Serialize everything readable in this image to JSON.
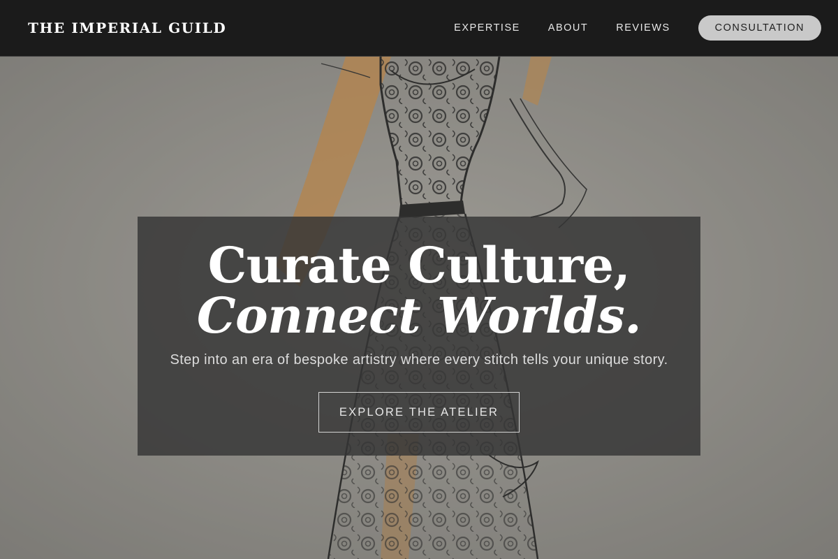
{
  "nav": {
    "brand": "THE IMPERIAL GUILD",
    "links": [
      "EXPERTISE",
      "ABOUT",
      "REVIEWS"
    ],
    "cta": "CONSULTATION"
  },
  "hero": {
    "headline_line1": "Curate Culture,",
    "headline_line2": "Connect Worlds.",
    "subheadline": "Step into an era of bespoke artistry where every stitch tells your unique story.",
    "cta": "EXPLORE THE ATELIER",
    "background_image": "fashion-sketch-lace-dress"
  },
  "colors": {
    "nav_bg": "#1b1b1b",
    "cta_pill_bg": "#c9c9c9",
    "panel_bg": "#343434",
    "accent_ochre": "#d2914a"
  }
}
